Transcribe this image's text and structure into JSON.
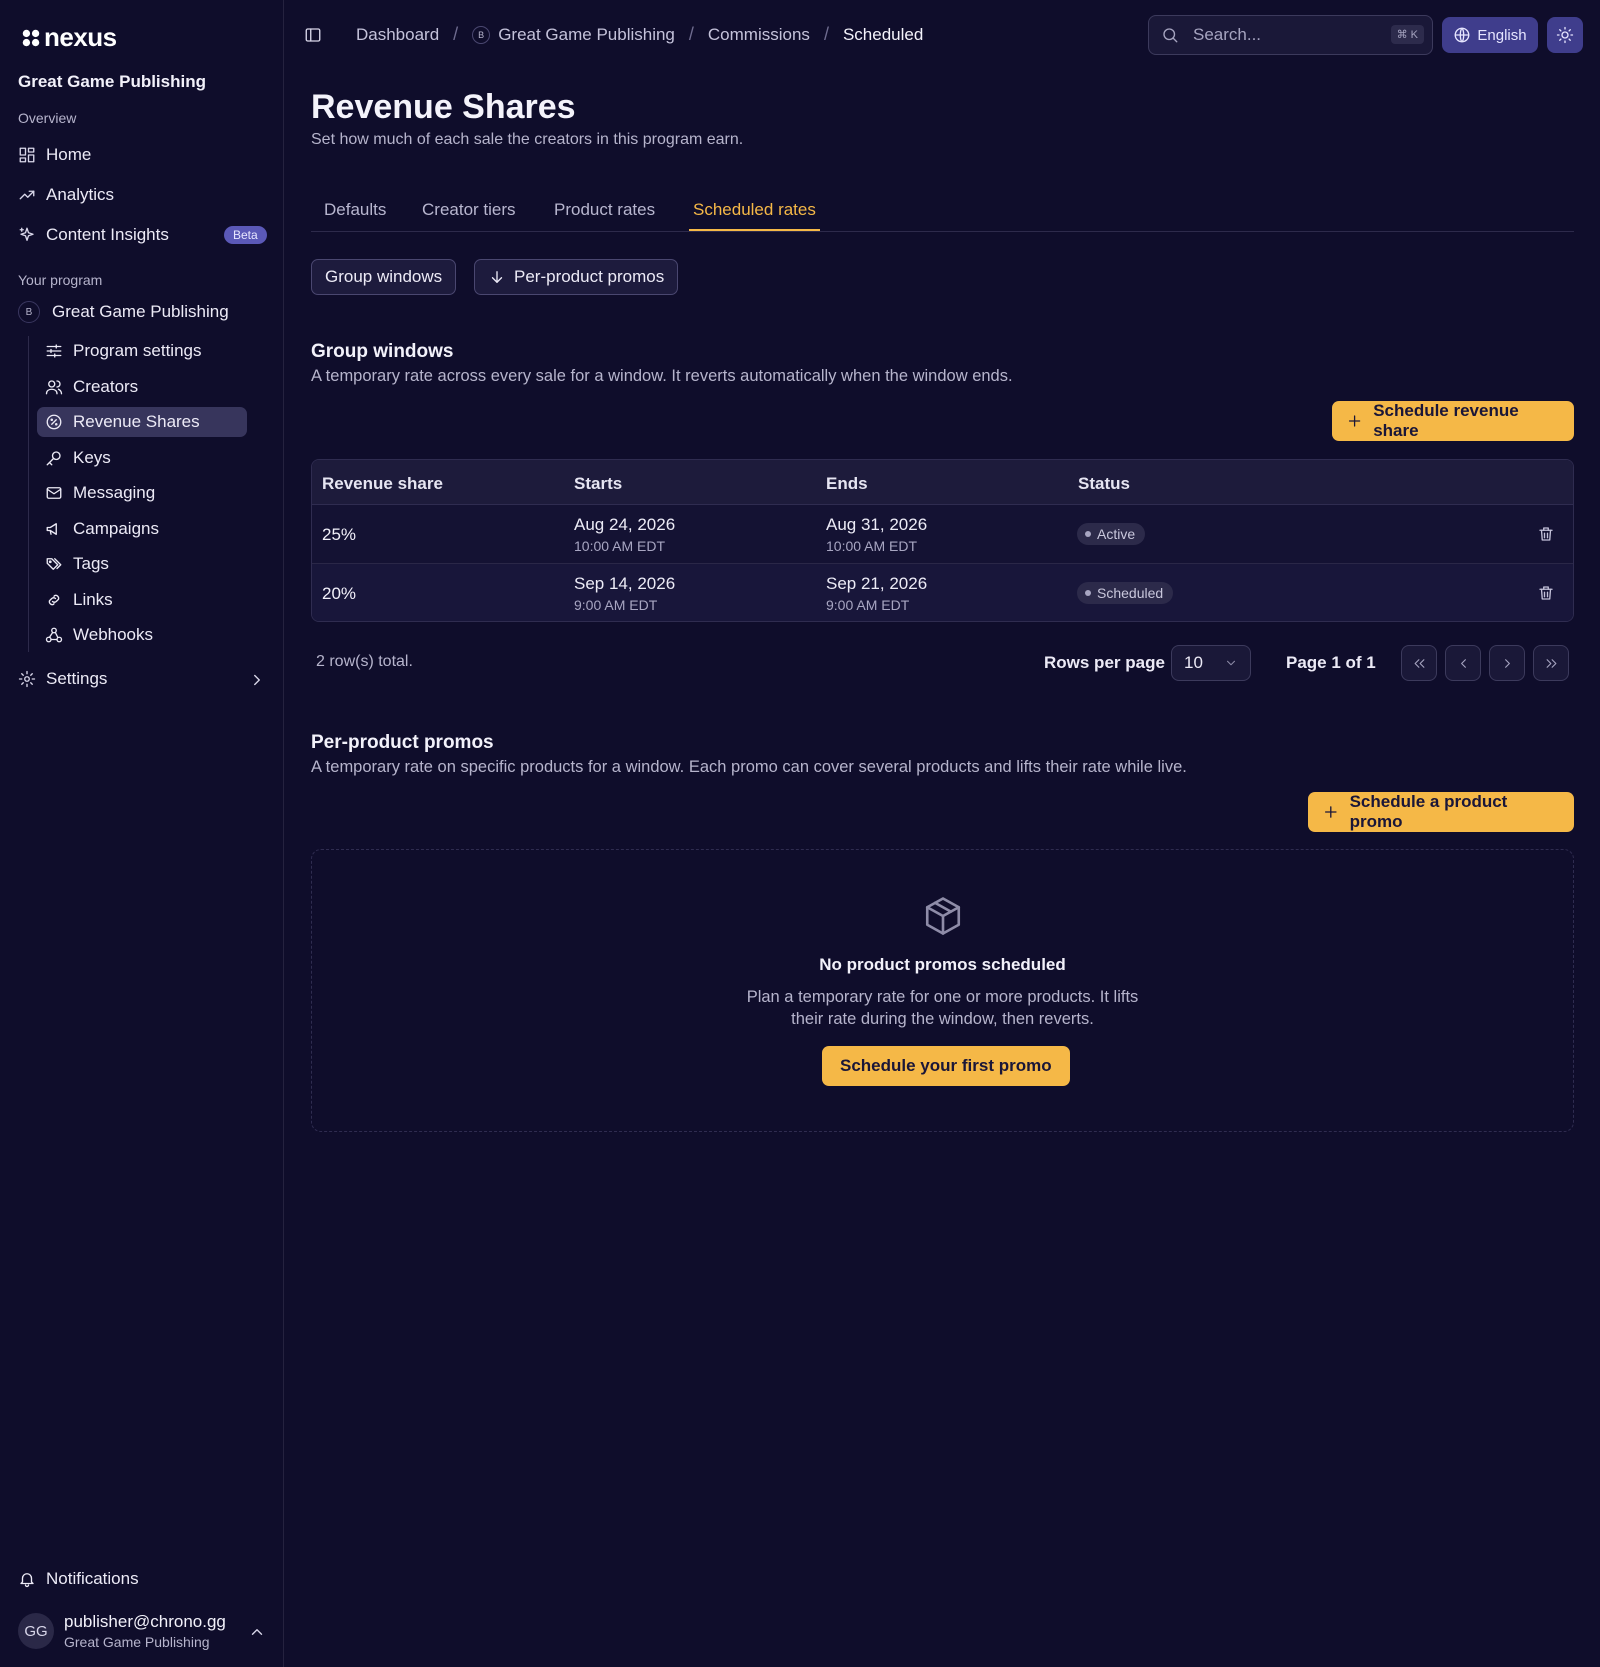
{
  "app": {
    "logo_text": "nexus"
  },
  "sidebar": {
    "org_title": "Great Game Publishing",
    "overview_label": "Overview",
    "overview_items": [
      {
        "label": "Home",
        "icon": "grid-icon"
      },
      {
        "label": "Analytics",
        "icon": "trending-up-icon"
      },
      {
        "label": "Content Insights",
        "icon": "sparkles-icon",
        "badge": "Beta"
      }
    ],
    "program_label": "Your program",
    "program": {
      "avatar": "B",
      "name": "Great Game Publishing"
    },
    "program_items": [
      {
        "label": "Program settings",
        "icon": "sliders-icon"
      },
      {
        "label": "Creators",
        "icon": "users-icon"
      },
      {
        "label": "Revenue Shares",
        "icon": "badge-percent-icon",
        "active": true
      },
      {
        "label": "Keys",
        "icon": "key-icon"
      },
      {
        "label": "Messaging",
        "icon": "mail-icon"
      },
      {
        "label": "Campaigns",
        "icon": "megaphone-icon"
      },
      {
        "label": "Tags",
        "icon": "tags-icon"
      },
      {
        "label": "Links",
        "icon": "link-icon"
      },
      {
        "label": "Webhooks",
        "icon": "webhook-icon"
      }
    ],
    "settings_label": "Settings",
    "notifications_label": "Notifications",
    "user": {
      "initials": "GG",
      "email": "publisher@chrono.gg",
      "org": "Great Game Publishing"
    }
  },
  "topbar": {
    "breadcrumb": [
      "Dashboard",
      "Great Game Publishing",
      "Commissions",
      "Scheduled"
    ],
    "breadcrumb_avatar": "B",
    "search_placeholder": "Search...",
    "search_shortcut": "⌘ K",
    "language": "English"
  },
  "page": {
    "title": "Revenue Shares",
    "subtitle": "Set how much of each sale the creators in this program earn.",
    "tabs": [
      "Defaults",
      "Creator tiers",
      "Product rates",
      "Scheduled rates"
    ],
    "active_tab": "Scheduled rates",
    "pills": [
      "Group windows",
      "Per-product promos"
    ]
  },
  "group_windows": {
    "title": "Group windows",
    "description": "A temporary rate across every sale for a window. It reverts automatically when the window ends.",
    "button": "Schedule revenue share",
    "columns": [
      "Revenue share",
      "Starts",
      "Ends",
      "Status"
    ],
    "rows": [
      {
        "share": "25%",
        "start_date": "Aug 24, 2026",
        "start_time": "10:00 AM EDT",
        "end_date": "Aug 31, 2026",
        "end_time": "10:00 AM EDT",
        "status": "Active"
      },
      {
        "share": "20%",
        "start_date": "Sep 14, 2026",
        "start_time": "9:00 AM EDT",
        "end_date": "Sep 21, 2026",
        "end_time": "9:00 AM EDT",
        "status": "Scheduled"
      }
    ],
    "total": "2 row(s) total.",
    "rows_per_page_label": "Rows per page",
    "rows_per_page": "10",
    "page_info": "Page 1 of 1"
  },
  "product_promos": {
    "title": "Per-product promos",
    "description": "A temporary rate on specific products for a window. Each promo can cover several products and lifts their rate while live.",
    "button": "Schedule a product promo",
    "empty_title": "No product promos scheduled",
    "empty_desc_line1": "Plan a temporary rate for one or more products. It lifts",
    "empty_desc_line2": "their rate during the window, then reverts.",
    "empty_button": "Schedule your first promo"
  },
  "colors": {
    "background": "#0f0d2b",
    "accent": "#f5b847",
    "active_nav": "#37355c",
    "chip": "#3f3d8c"
  }
}
